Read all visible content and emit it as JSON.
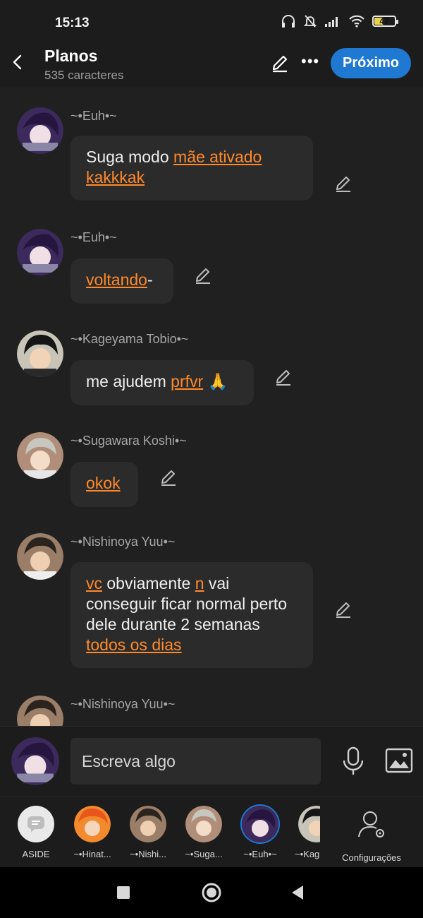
{
  "status": {
    "time": "15:13",
    "battery": "47",
    "battery_level": 0.47
  },
  "header": {
    "title": "Planos",
    "subtitle": "535 caracteres",
    "next_label": "Próximo"
  },
  "messages": [
    {
      "author": "~•Euh•~",
      "segments": [
        {
          "t": "Suga modo ",
          "link": false
        },
        {
          "t": "mãe ativado kakkkak",
          "link": true
        }
      ]
    },
    {
      "author": "~•Euh•~",
      "segments": [
        {
          "t": "voltando",
          "link": true
        },
        {
          "t": "-",
          "link": false
        }
      ]
    },
    {
      "author": "~•Kageyama Tobio•~",
      "segments": [
        {
          "t": "me ajudem ",
          "link": false
        },
        {
          "t": "prfvr",
          "link": true
        },
        {
          "t": " 🙏",
          "link": false
        }
      ]
    },
    {
      "author": "~•Sugawara Koshi•~",
      "segments": [
        {
          "t": "okok",
          "link": true
        }
      ]
    },
    {
      "author": "~•Nishinoya Yuu•~",
      "segments": [
        {
          "t": "vc",
          "link": true
        },
        {
          "t": " obviamente ",
          "link": false
        },
        {
          "t": "n",
          "link": true
        },
        {
          "t": " vai conseguir ficar normal perto dele durante 2 semanas ",
          "link": false
        },
        {
          "t": "todos os dias",
          "link": true
        }
      ]
    },
    {
      "author": "~•Nishinoya Yuu•~",
      "segments": []
    }
  ],
  "composer": {
    "placeholder": "Escreva algo"
  },
  "characters": [
    {
      "label": "ASIDE"
    },
    {
      "label": "~•Hinat..."
    },
    {
      "label": "~•Nishi..."
    },
    {
      "label": "~•Suga..."
    },
    {
      "label": "~•Euh•~"
    },
    {
      "label": "~•Kag"
    }
  ],
  "settings_label": "Configurações",
  "colors": {
    "accent": "#1f78d1",
    "link": "#ff8a2a",
    "background": "#202020"
  }
}
